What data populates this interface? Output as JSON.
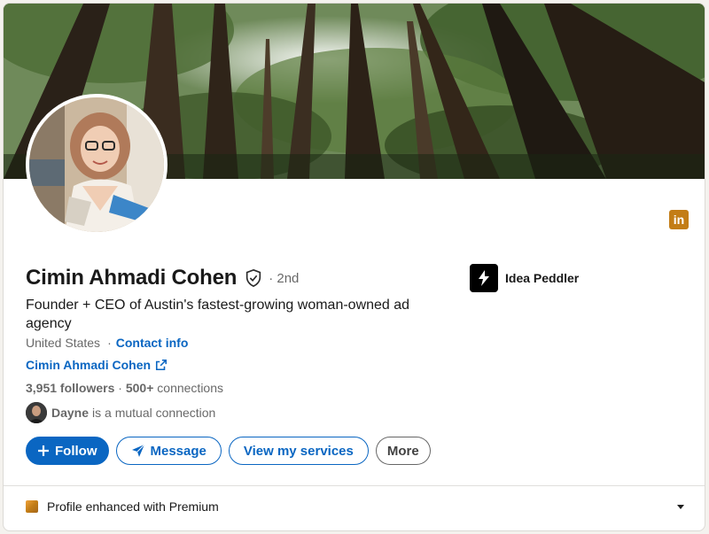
{
  "profile": {
    "name": "Cimin Ahmadi Cohen",
    "degree": "· 2nd",
    "headline": "Founder + CEO of Austin's fastest-growing woman-owned ad agency",
    "location": "United States",
    "separator": "·",
    "contact_info": "Contact info",
    "website": "Cimin Ahmadi Cohen",
    "followers": "3,951 followers",
    "stats_sep": " · ",
    "connections_count": "500+",
    "connections_label": " connections",
    "mutual_name": "Dayne",
    "mutual_text": "is a mutual connection"
  },
  "company": {
    "name": "Idea Peddler"
  },
  "actions": {
    "follow": "Follow",
    "message": "Message",
    "services": "View my services",
    "more": "More"
  },
  "premium": {
    "label": "Profile enhanced with Premium"
  },
  "colors": {
    "accent": "#0a66c2",
    "premium_gold": "#c37d16",
    "linkedin_badge": "#c37d16"
  },
  "icons": {
    "verified": "shield-check-icon",
    "external": "external-link-icon",
    "message": "paper-plane-icon",
    "follow": "plus-icon",
    "linkedin": "linkedin-icon",
    "company": "lightning-bolt-icon",
    "premium": "premium-gold-icon",
    "chevron": "chevron-down-icon"
  }
}
